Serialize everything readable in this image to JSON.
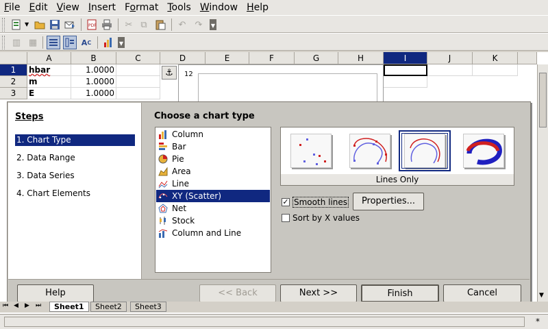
{
  "menubar": {
    "items": [
      {
        "label": "File",
        "mnemonic": "F"
      },
      {
        "label": "Edit",
        "mnemonic": "E"
      },
      {
        "label": "View",
        "mnemonic": "V"
      },
      {
        "label": "Insert",
        "mnemonic": "I"
      },
      {
        "label": "Format",
        "mnemonic": "o"
      },
      {
        "label": "Tools",
        "mnemonic": "T"
      },
      {
        "label": "Window",
        "mnemonic": "W"
      },
      {
        "label": "Help",
        "mnemonic": "H"
      }
    ]
  },
  "sheet": {
    "columns": [
      "A",
      "B",
      "C",
      "D",
      "E",
      "F",
      "G",
      "H",
      "I",
      "J",
      "K"
    ],
    "selected_column": "I",
    "rows": [
      "1",
      "2",
      "3"
    ],
    "selected_row": "1",
    "cells": [
      {
        "a": "hbar",
        "b": "1.0000"
      },
      {
        "a": "m",
        "b": "1.0000"
      },
      {
        "a": "E",
        "b": "1.0000"
      }
    ],
    "chart_tick": "12",
    "tabs": [
      "Sheet1",
      "Sheet2",
      "Sheet3"
    ]
  },
  "dialog": {
    "steps_title": "Steps",
    "steps": [
      "1. Chart Type",
      "2. Data Range",
      "3. Data Series",
      "4. Chart Elements"
    ],
    "selected_step": 0,
    "chart_type_title": "Choose a chart type",
    "chart_types": [
      "Column",
      "Bar",
      "Pie",
      "Area",
      "Line",
      "XY (Scatter)",
      "Net",
      "Stock",
      "Column and Line"
    ],
    "selected_type": 5,
    "variant_label": "Lines Only",
    "smooth_lines": {
      "label": "Smooth lines",
      "checked": true
    },
    "properties_button": "Properties...",
    "sort_by_x": {
      "label": "Sort by X values",
      "checked": false
    },
    "buttons": {
      "help": "Help",
      "back": "<< Back",
      "next": "Next >>",
      "finish": "Finish",
      "cancel": "Cancel"
    }
  },
  "statusbar": {
    "indicator": "*"
  }
}
